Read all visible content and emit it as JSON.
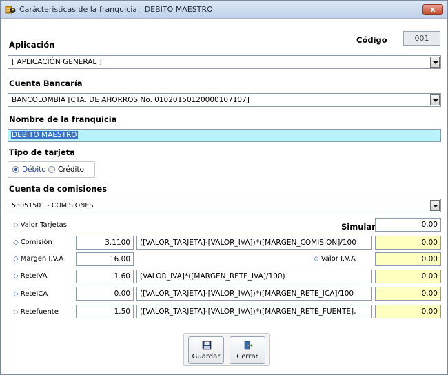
{
  "window": {
    "title": "Carácteristicas de la franquicia : DEBITO MAESTRO",
    "close_label": "x"
  },
  "aplicacion": {
    "label": "Aplicación",
    "value": "[ APLICACIÓN GENERAL ]"
  },
  "codigo": {
    "label": "Código",
    "value": "001"
  },
  "cuenta_bancaria": {
    "label": "Cuenta Bancaría",
    "value": "BANCOLOMBIA [CTA. DE AHORROS No. 01020150120000107107]"
  },
  "nombre_franquicia": {
    "label": "Nombre de la franquicia",
    "value": "DEBITO MAESTRO"
  },
  "tipo_tarjeta": {
    "label": "Tipo de tarjeta",
    "options": [
      "Débito",
      "Crédito"
    ],
    "selected": "Débito"
  },
  "cuenta_comisiones": {
    "label": "Cuenta de comisiones",
    "value": "53051501 - COMISIONES"
  },
  "valores": {
    "valor_tarjetas_label": "Valor Tarjetas",
    "simular_label": "Simular",
    "simular_value": "0.00",
    "valor_iva_label": "Valor I.V.A",
    "valor_iva_value": "0.00",
    "rows": [
      {
        "label": "Comisión",
        "value": "3.1100",
        "formula": "([VALOR_TARJETA]-[VALOR_IVA])*([MARGEN_COMISION]/100",
        "result": "0.00"
      },
      {
        "label": "Margen I.V.A",
        "value": "16.00",
        "formula": "",
        "result": "0.00"
      },
      {
        "label": "ReteIVA",
        "value": "1.60",
        "formula": "[VALOR_IVA]*([MARGEN_RETE_IVA]/100)",
        "result": "0.00"
      },
      {
        "label": "ReteICA",
        "value": "0.00",
        "formula": "([VALOR_TARJETA]-[VALOR_IVA])*([MARGEN_RETE_ICA]/100",
        "result": "0.00"
      },
      {
        "label": "Retefuente",
        "value": "1.50",
        "formula": "([VALOR_TARJETA]-[VALOR_IVA])*([MARGEN_RETE_FUENTE],",
        "result": "0.00"
      }
    ]
  },
  "buttons": {
    "guardar": "Guardar",
    "cerrar": "Cerrar"
  },
  "colors": {
    "name_field_bg": "#b8f2fb",
    "result_field_bg": "#ffffc0",
    "selection": "#3b74c8"
  }
}
